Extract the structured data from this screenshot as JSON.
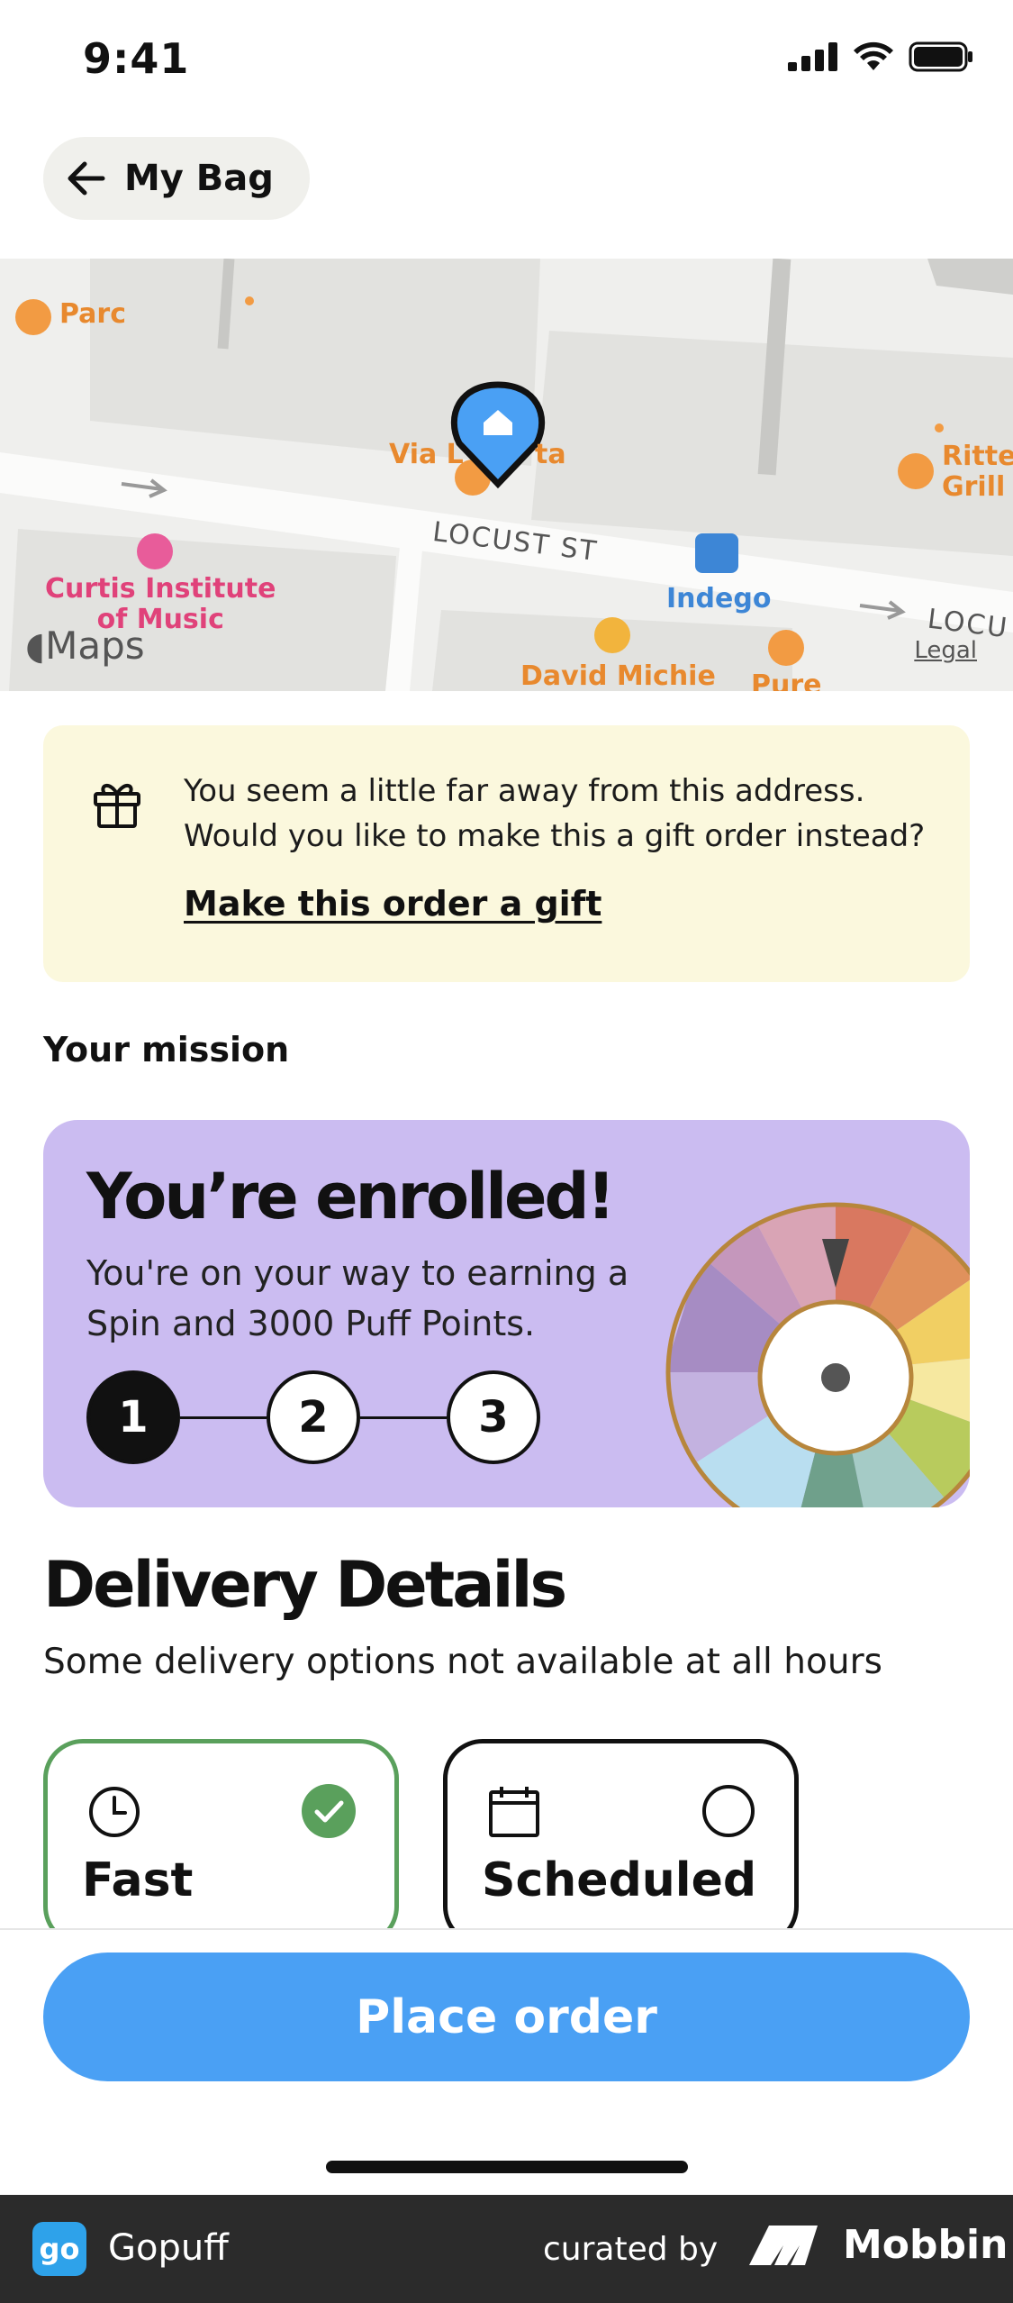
{
  "status_bar": {
    "time": "9:41"
  },
  "header": {
    "back_label": "My Bag"
  },
  "map": {
    "labels": {
      "parc": "Parc",
      "via": "Via L",
      "via_suffix": "ta",
      "ritten": "Ritte",
      "grill": "Grill",
      "street": "LOCUST ST",
      "street_right": "LOCU",
      "curtis_line1": "Curtis Institute",
      "curtis_line2": "of Music",
      "indego": "Indego",
      "david": "David Michie",
      "pure": "Pure"
    },
    "brand": "Maps",
    "legal": "Legal"
  },
  "gift_banner": {
    "text_line1": "You seem a little far away from this address.",
    "text_line2": "Would you like to make this a gift order instead?",
    "link": "Make this order a gift"
  },
  "mission": {
    "section_label": "Your mission",
    "title": "You’re enrolled!",
    "subtitle_line1": "You're on your way to earning a",
    "subtitle_line2": "Spin and 3000 Puff Points.",
    "steps": [
      "1",
      "2",
      "3"
    ]
  },
  "delivery": {
    "title": "Delivery Details",
    "subtitle": "Some delivery options not available at all hours",
    "options": [
      {
        "label": "Fast",
        "icon": "clock-icon",
        "selected": true
      },
      {
        "label": "Scheduled",
        "icon": "calendar-icon",
        "selected": false
      }
    ]
  },
  "footer": {
    "place_order": "Place order"
  },
  "brand_bar": {
    "app_logo": "go",
    "app_name": "Gopuff",
    "curated_by": "curated by",
    "curator": "Mobbin"
  },
  "colors": {
    "primary_button": "#4aa0f4",
    "selected_green": "#5aa05c",
    "mission_bg": "#cbbcf1",
    "gift_bg": "#fbf8dd"
  }
}
